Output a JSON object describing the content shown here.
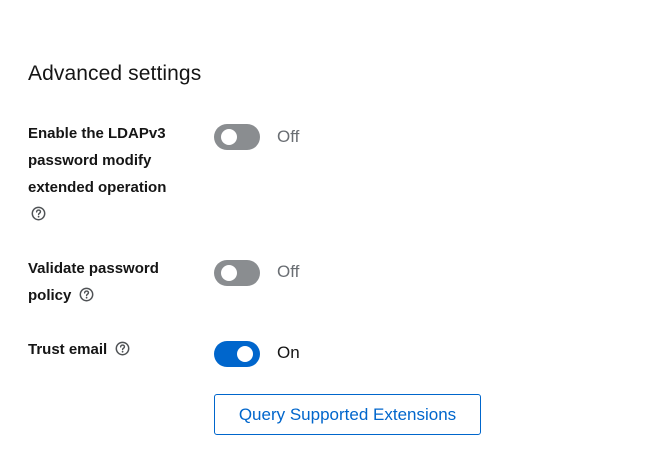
{
  "section": {
    "title": "Advanced settings"
  },
  "settings": [
    {
      "label_lines": [
        "Enable the LDAPv3",
        "password modify",
        "extended operation"
      ],
      "state": "Off",
      "enabled": false
    },
    {
      "label_lines": [
        "Validate password",
        "policy"
      ],
      "state": "Off",
      "enabled": false
    },
    {
      "label_lines": [
        "Trust email"
      ],
      "state": "On",
      "enabled": true
    }
  ],
  "actions": {
    "query_button": "Query Supported Extensions"
  },
  "colors": {
    "accent": "#0066cc",
    "toggle_off": "#8a8d90",
    "off_text": "#6a6e73"
  },
  "icons": {
    "help": "question-circle-icon"
  }
}
